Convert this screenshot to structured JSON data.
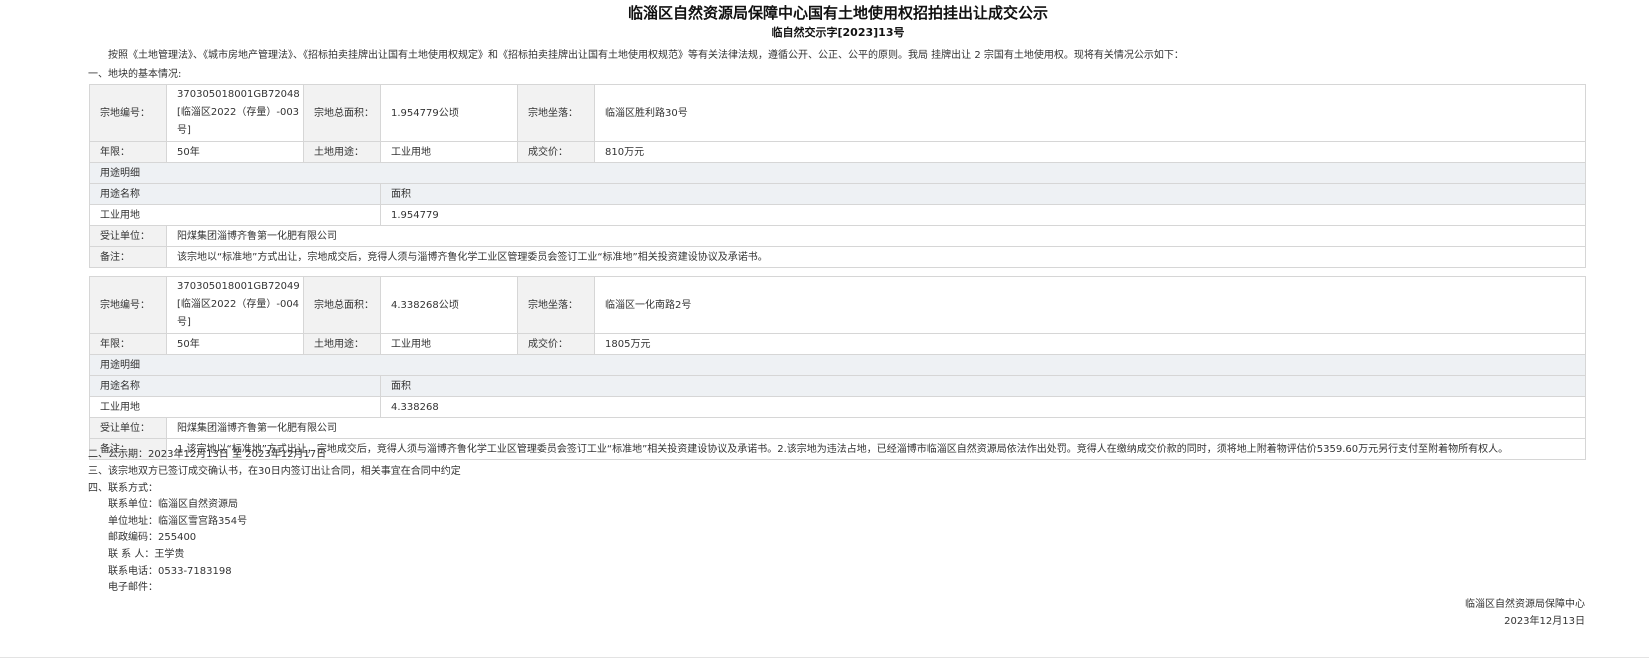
{
  "doc": {
    "title": "临淄区自然资源局保障中心国有土地使用权招拍挂出让成交公示",
    "subtitle": "临自然交示字[2023]13号",
    "intro": "按照《土地管理法》、《城市房地产管理法》、《招标拍卖挂牌出让国有土地使用权规定》和《招标拍卖挂牌出让国有土地使用权规范》等有关法律法规，遵循公开、公正、公平的原则。我局 挂牌出让 2 宗国有土地使用权。现将有关情况公示如下：",
    "section1": "一、地块的基本情况:"
  },
  "labels": {
    "parcel_no": "宗地编号：",
    "area": "宗地总面积：",
    "location": "宗地坐落：",
    "term": "年限：",
    "use": "土地用途：",
    "price": "成交价：",
    "use_detail": "用途明细",
    "use_name": "用途名称",
    "area_col": "面积",
    "transferee": "受让单位：",
    "remark": "备注："
  },
  "parcels": [
    {
      "no": "370305018001GB72048 [临淄区2022（存量）-003号]",
      "area": "1.954779公顷",
      "location": "临淄区胜利路30号",
      "term": "50年",
      "use": "工业用地",
      "price": "810万元",
      "detail_use": "工业用地",
      "detail_area": "1.954779",
      "transferee": "阳煤集团淄博齐鲁第一化肥有限公司",
      "remark": "该宗地以“标准地”方式出让，宗地成交后，竞得人须与淄博齐鲁化学工业区管理委员会签订工业“标准地”相关投资建设协议及承诺书。"
    },
    {
      "no": "370305018001GB72049 [临淄区2022（存量）-004号]",
      "area": "4.338268公顷",
      "location": "临淄区一化南路2号",
      "term": "50年",
      "use": "工业用地",
      "price": "1805万元",
      "detail_use": "工业用地",
      "detail_area": "4.338268",
      "transferee": "阳煤集团淄博齐鲁第一化肥有限公司",
      "remark": "1.该宗地以“标准地”方式出让，宗地成交后，竞得人须与淄博齐鲁化学工业区管理委员会签订工业“标准地”相关投资建设协议及承诺书。2.该宗地为违法占地，已经淄博市临淄区自然资源局依法作出处罚。竞得人在缴纳成交价款的同时，须将地上附着物评估价5359.60万元另行支付至附着物所有权人。"
    }
  ],
  "footer": {
    "period": "二、公示期：2023年12月13日 至 2023年12月17日",
    "contract": "三、该宗地双方已签订成交确认书，在30日内签订出让合同，相关事宜在合同中约定",
    "contact_head": "四、联系方式：",
    "unit": "联系单位：临淄区自然资源局",
    "address": "单位地址：临淄区雪宫路354号",
    "postcode": "邮政编码：255400",
    "person": "联 系 人：王学贵",
    "phone": "联系电话：0533-7183198",
    "email": "电子邮件："
  },
  "signature": {
    "org": "临淄区自然资源局保障中心",
    "date": "2023年12月13日"
  }
}
